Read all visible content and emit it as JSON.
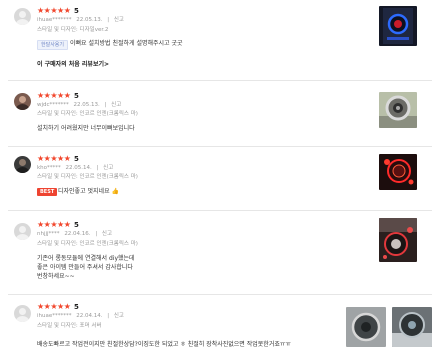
{
  "reviews": [
    {
      "score": "5",
      "user": "ihuae*******",
      "date": "22.05.13.",
      "report": "신고",
      "option": "스타일 및 디자인: 디자일ver.2",
      "badge": "한달사용기",
      "text": "이뻐요 설치방법 친절하게 설명해주시고 굿굿",
      "more_link": "이 구매자의 처음 리뷰보기>"
    },
    {
      "score": "5",
      "user": "wjdc*******",
      "date": "22.05.13.",
      "report": "신고",
      "option": "스타일 및 디자인: 인코르 인젠(크롬릭스 마)",
      "text": "설치하기 어려웠지만 너무이뻐보입니다"
    },
    {
      "score": "5",
      "user": "kho*****",
      "date": "22.05.14.",
      "report": "신고",
      "option": "스타일 및 디자인: 인코르 인젠(크롬릭스 마)",
      "badge": "BEST",
      "text": "디자인좋고 멋지네요 👍"
    },
    {
      "score": "5",
      "user": "nhjjj****",
      "date": "22.04.16.",
      "report": "신고",
      "option": "스타일 및 디자인: 인코르 인젠(크롬릭스 마)",
      "text_lines": [
        "기존어 롱동모듈에 연결해서 diy했는데",
        "좋은 아이템 만들어 주셔서 감사합니다",
        "번창하세요~~"
      ]
    },
    {
      "score": "5",
      "user": "ihuae*******",
      "date": "22.04.14.",
      "report": "신고",
      "option": "스타일 및 디자인: 포머 서버",
      "text": "배송도빠르고 작업전이지만 친절한상담?이징도한 되었고 ㅎ 친절히 장착사진없으면 작업못한거죠ㅠㅠ"
    }
  ],
  "colors": {
    "star": "#f1462c",
    "best_badge": "#ee4431",
    "month_badge_text": "#6d84c4"
  },
  "icons": [
    "default-avatar-icon",
    "star-icon"
  ]
}
